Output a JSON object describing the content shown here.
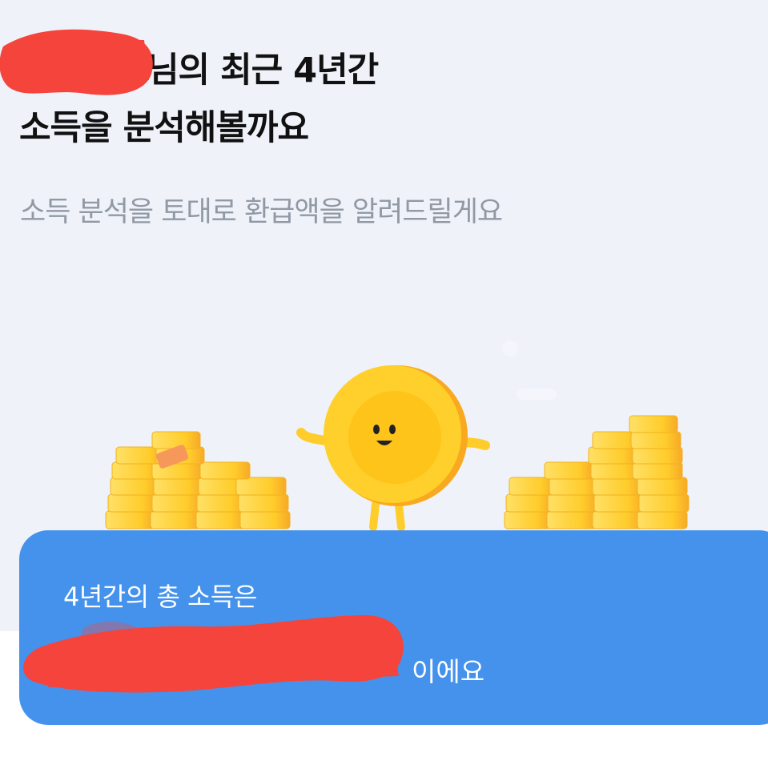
{
  "header": {
    "title_line1": "님의 최근 4년간",
    "title_line2": "소득을 분석해볼까요",
    "subtitle": "소득 분석을 토대로 환급액을 알려드릴게요"
  },
  "income_card": {
    "label": "4년간의 총 소득은",
    "amount": "",
    "suffix": "이에요"
  },
  "colors": {
    "background": "#eff2f9",
    "card": "#4592ec",
    "subtitle_text": "#9199a5",
    "coin": "#ffd02b",
    "redaction": "#f4443b"
  },
  "icons": {
    "mascot": "coin-mascot-icon",
    "coins": "coin-stack-icon"
  }
}
